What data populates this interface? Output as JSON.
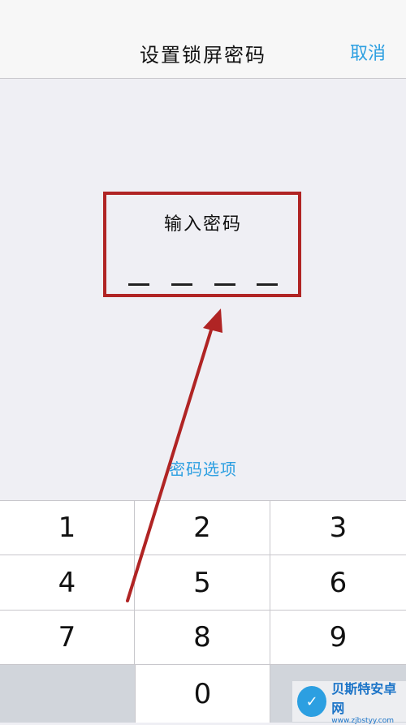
{
  "header": {
    "title": "设置锁屏密码",
    "cancel_label": "取消"
  },
  "passcode": {
    "prompt": "输入密码",
    "slots": 4,
    "options_label": "密码选项"
  },
  "keypad": {
    "keys": [
      "1",
      "2",
      "3",
      "4",
      "5",
      "6",
      "7",
      "8",
      "9",
      "0"
    ]
  },
  "annotation": {
    "color": "#b02424"
  },
  "accent_color": "#2c9fe1",
  "watermark": {
    "main": "贝斯特安卓网",
    "sub": "www.zjbstyy.com"
  }
}
